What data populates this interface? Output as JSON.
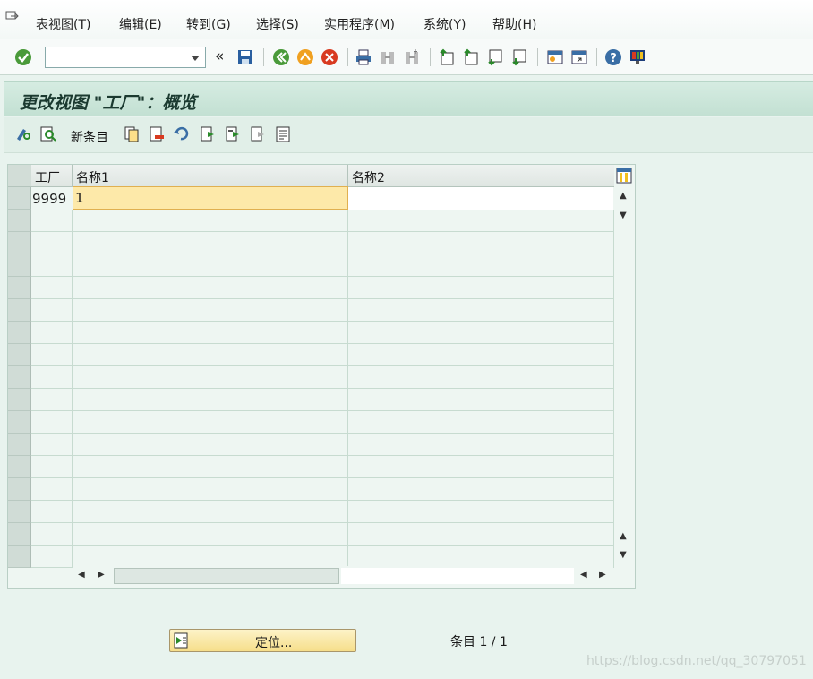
{
  "menu": [
    "表视图(T)",
    "编辑(E)",
    "转到(G)",
    "选择(S)",
    "实用程序(M)",
    "系统(Y)",
    "帮助(H)"
  ],
  "toolbar": {
    "command_value": "",
    "icons": [
      "enter-icon",
      "back-icon",
      "exit-icon",
      "cancel-icon",
      "print-icon",
      "find-icon",
      "find-next-icon",
      "first-page-icon",
      "prev-page-icon",
      "next-page-icon",
      "last-page-icon",
      "create-session-icon",
      "shortcut-icon",
      "help-icon",
      "customize-layout-icon"
    ]
  },
  "title": "更改视图 \"工厂\"：概览",
  "app_toolbar": {
    "new_entries_label": "新条目"
  },
  "table": {
    "columns": [
      "工厂",
      "名称1",
      "名称2"
    ],
    "rows": [
      {
        "plant": "9999",
        "name1": "1",
        "name2": ""
      }
    ]
  },
  "footer": {
    "locate_label": "定位...",
    "entry_count": "条目 1 / 1"
  },
  "watermark": "https://blog.csdn.net/qq_30797051"
}
